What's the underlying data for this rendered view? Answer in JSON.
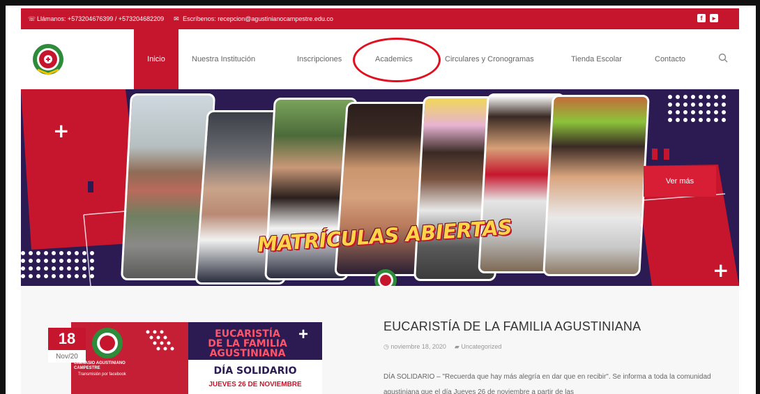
{
  "topbar": {
    "phone_text": "Llámanos: +573204676399 / +573204682209",
    "email_text": "Escríbenos: recepcion@agustinianocampestre.edu.co",
    "phone_icon": "phone-icon",
    "email_icon": "envelope-icon",
    "social": [
      {
        "icon": "facebook-icon",
        "glyph": "f"
      },
      {
        "icon": "youtube-icon",
        "glyph": "▸"
      }
    ]
  },
  "nav": {
    "items": [
      {
        "label": "Inicio",
        "active": true
      },
      {
        "label": "Nuestra Institución"
      },
      {
        "label": "Inscripciones"
      },
      {
        "label": "Academics"
      },
      {
        "label": "Circulares y Cronogramas"
      },
      {
        "label": "Tienda Escolar"
      },
      {
        "label": "Contacto"
      }
    ]
  },
  "banner": {
    "headline": "MATRÍCULAS ABIERTAS",
    "cta_label": "Ver más"
  },
  "post": {
    "day": "18",
    "month": "Nov/20",
    "title": "EUCARISTÍA DE LA FAMILIA AGUSTINIANA",
    "meta_date": "noviembre 18, 2020",
    "meta_category": "Uncategorized",
    "excerpt": "DÍA SOLIDARIO – \"Recuerda que hay más alegría en dar que en recibir\". Se informa a toda la comunidad agustiniana que el día Jueves 26 de noviembre a partir de las",
    "thumb": {
      "line1": "EUCARISTÍA",
      "line2": "DE LA FAMILIA",
      "line3": "AGUSTINIANA",
      "line4": "DÍA SOLIDARIO",
      "line5": "JUEVES 26 DE NOVIEMBRE",
      "school": "GIMNASIO AGUSTINIANO CAMPESTRE",
      "stream": "Transmisión por facebook"
    }
  },
  "colors": {
    "brand_red": "#c6162d",
    "banner_navy": "#2b1b52",
    "headline_yellow": "#ffd44a"
  }
}
